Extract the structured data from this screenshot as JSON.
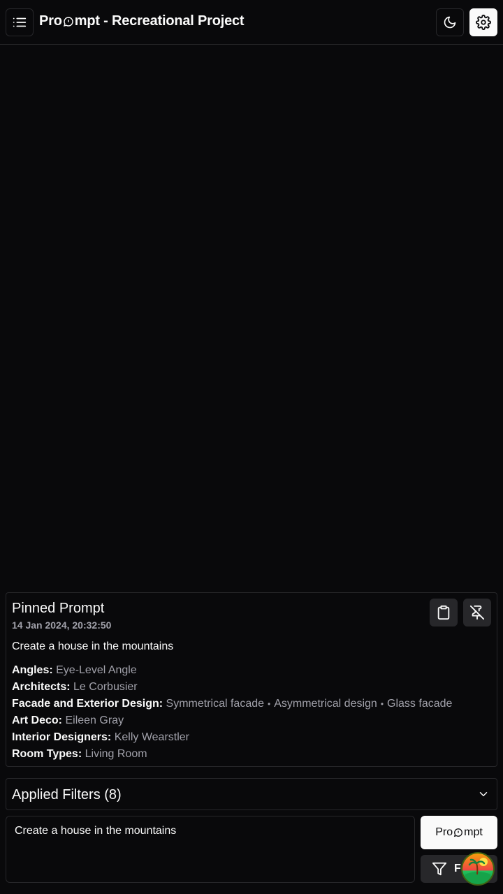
{
  "header": {
    "title_before": "Pro",
    "title_after": "mpt - Recreational Project",
    "menu_icon": "list-icon",
    "theme_icon": "moon-icon",
    "settings_icon": "gear-icon"
  },
  "pinned": {
    "title": "Pinned Prompt",
    "date": "14 Jan 2024, 20:32:50",
    "text": "Create a house in the mountains",
    "copy_icon": "clipboard-icon",
    "unpin_icon": "pin-off-icon",
    "details": [
      {
        "key": "Angles:",
        "values": [
          "Eye-Level Angle"
        ]
      },
      {
        "key": "Architects:",
        "values": [
          "Le Corbusier"
        ]
      },
      {
        "key": "Facade and Exterior Design:",
        "values": [
          "Symmetrical facade",
          "Asymmetrical design",
          "Glass facade"
        ]
      },
      {
        "key": "Art Deco:",
        "values": [
          "Eileen Gray"
        ]
      },
      {
        "key": "Interior Designers:",
        "values": [
          "Kelly Wearstler"
        ]
      },
      {
        "key": "Room Types:",
        "values": [
          "Living Room"
        ]
      }
    ],
    "separator": "•"
  },
  "filters": {
    "label": "Applied Filters (8)",
    "icon": "chevron-down-icon"
  },
  "composer": {
    "value": "Create a house in the mountains",
    "prompt_label_before": "Pro",
    "prompt_label_after": "mpt",
    "filter_label": "F",
    "filter_icon": "funnel-icon"
  },
  "colors": {
    "background": "#09090b",
    "border": "#27272a",
    "muted_text": "#a1a1aa",
    "foreground": "#fafafa"
  }
}
